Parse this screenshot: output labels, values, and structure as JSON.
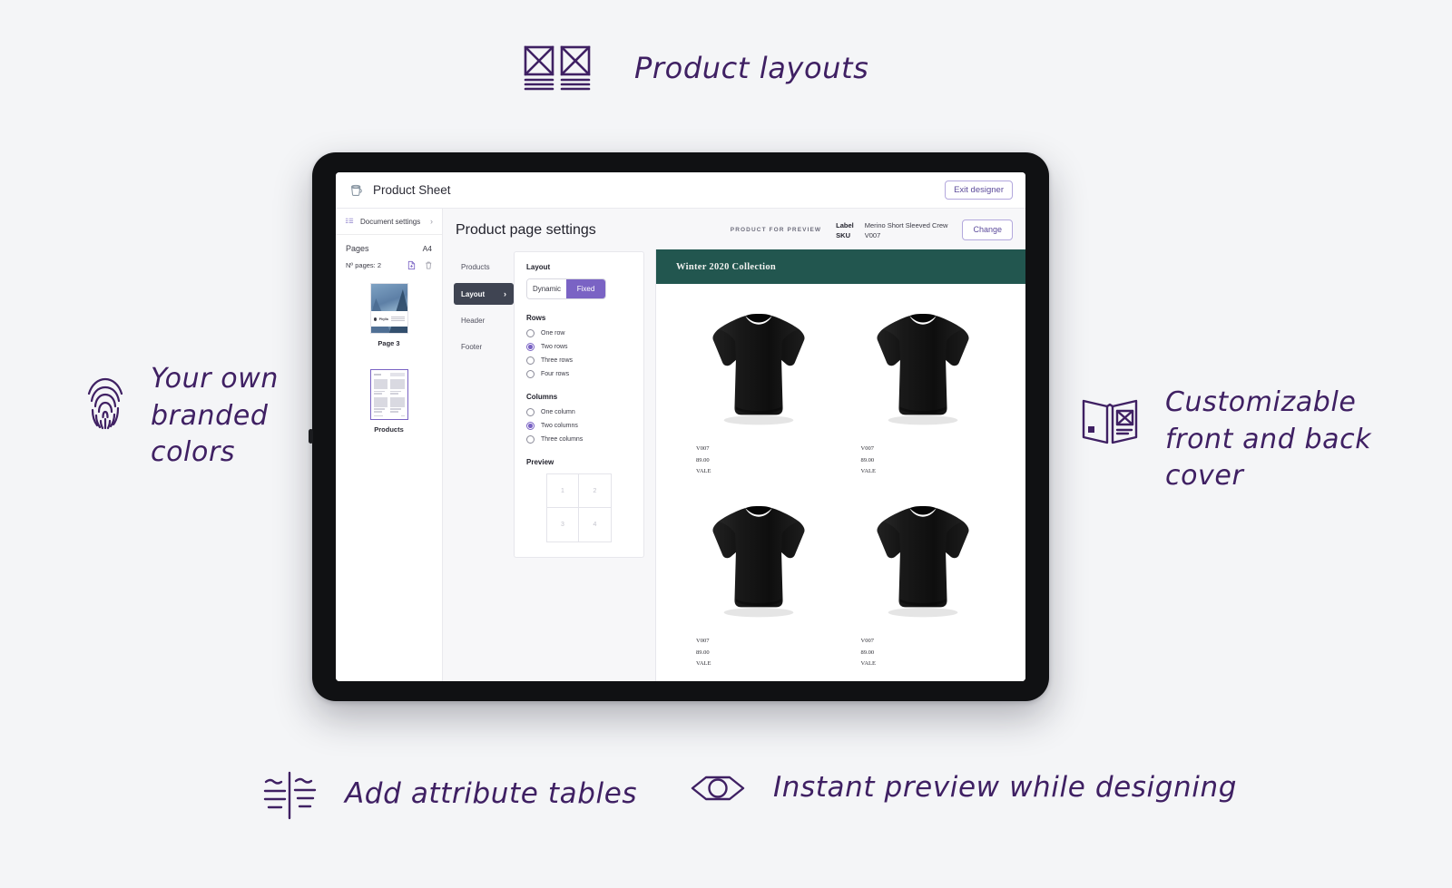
{
  "annotations": [
    {
      "id": "product-layouts",
      "icon": "two-page-layout-icon",
      "text": "Product layouts"
    },
    {
      "id": "branded-colors",
      "icon": "fingerprint-icon",
      "text": "Your own\nbranded\ncolors"
    },
    {
      "id": "custom-cover",
      "icon": "open-brochure-icon",
      "text": "Customizable\nfront and back\ncover"
    },
    {
      "id": "attribute-tables",
      "icon": "attribute-table-icon",
      "text": "Add attribute tables"
    },
    {
      "id": "instant-preview",
      "icon": "eye-icon",
      "text": "Instant preview while designing"
    }
  ],
  "app": {
    "topbar": {
      "logo_icon": "paint-bucket-icon",
      "title": "Product Sheet",
      "exit_label": "Exit designer"
    },
    "sidebar": {
      "document_settings_label": "Document settings",
      "document_settings_icon": "list-settings-icon",
      "chevron_icon": "chevron-right-icon",
      "pages_label": "Pages",
      "page_size": "A4",
      "num_pages_label": "Nº pages: 2",
      "duplicate_icon": "duplicate-page-icon",
      "delete_icon": "trash-icon",
      "thumbnails": [
        {
          "label": "Page 3",
          "selected": false,
          "kind": "cover",
          "logo_text": "Phylla"
        },
        {
          "label": "Products",
          "selected": true,
          "kind": "products"
        }
      ]
    },
    "main": {
      "page_title": "Product page settings",
      "preview_kicker": "PRODUCT FOR PREVIEW",
      "label_key": "Label",
      "label_value": "Merino Short Sleeved Crew",
      "sku_key": "SKU",
      "sku_value": "V007",
      "change_label": "Change",
      "settings_nav": [
        {
          "label": "Products",
          "active": false
        },
        {
          "label": "Layout",
          "active": true
        },
        {
          "label": "Header",
          "active": false
        },
        {
          "label": "Footer",
          "active": false
        }
      ],
      "layout_card": {
        "layout_heading": "Layout",
        "modes": [
          {
            "label": "Dynamic",
            "selected": false
          },
          {
            "label": "Fixed",
            "selected": true
          }
        ],
        "rows_heading": "Rows",
        "rows_options": [
          {
            "label": "One row",
            "selected": false
          },
          {
            "label": "Two rows",
            "selected": true
          },
          {
            "label": "Three rows",
            "selected": false
          },
          {
            "label": "Four rows",
            "selected": false
          }
        ],
        "columns_heading": "Columns",
        "columns_options": [
          {
            "label": "One column",
            "selected": false
          },
          {
            "label": "Two columns",
            "selected": true
          },
          {
            "label": "Three columns",
            "selected": false
          }
        ],
        "preview_heading": "Preview",
        "preview_cells": [
          "1",
          "2",
          "3",
          "4"
        ]
      },
      "document_preview": {
        "band_title": "Winter 2020 Collection",
        "products": [
          {
            "sku": "V007",
            "price": "89.00",
            "brand": "VALE"
          },
          {
            "sku": "V007",
            "price": "89.00",
            "brand": "VALE"
          },
          {
            "sku": "V007",
            "price": "89.00",
            "brand": "VALE"
          },
          {
            "sku": "V007",
            "price": "89.00",
            "brand": "VALE"
          }
        ]
      }
    }
  },
  "colors": {
    "page_background": "#f4f5f7",
    "annotation_purple": "#3f2063",
    "accent_purple": "#7a63c4",
    "nav_active_slate": "#3f4452",
    "doc_band_teal": "#22564f",
    "tablet_bezel": "#101113"
  }
}
